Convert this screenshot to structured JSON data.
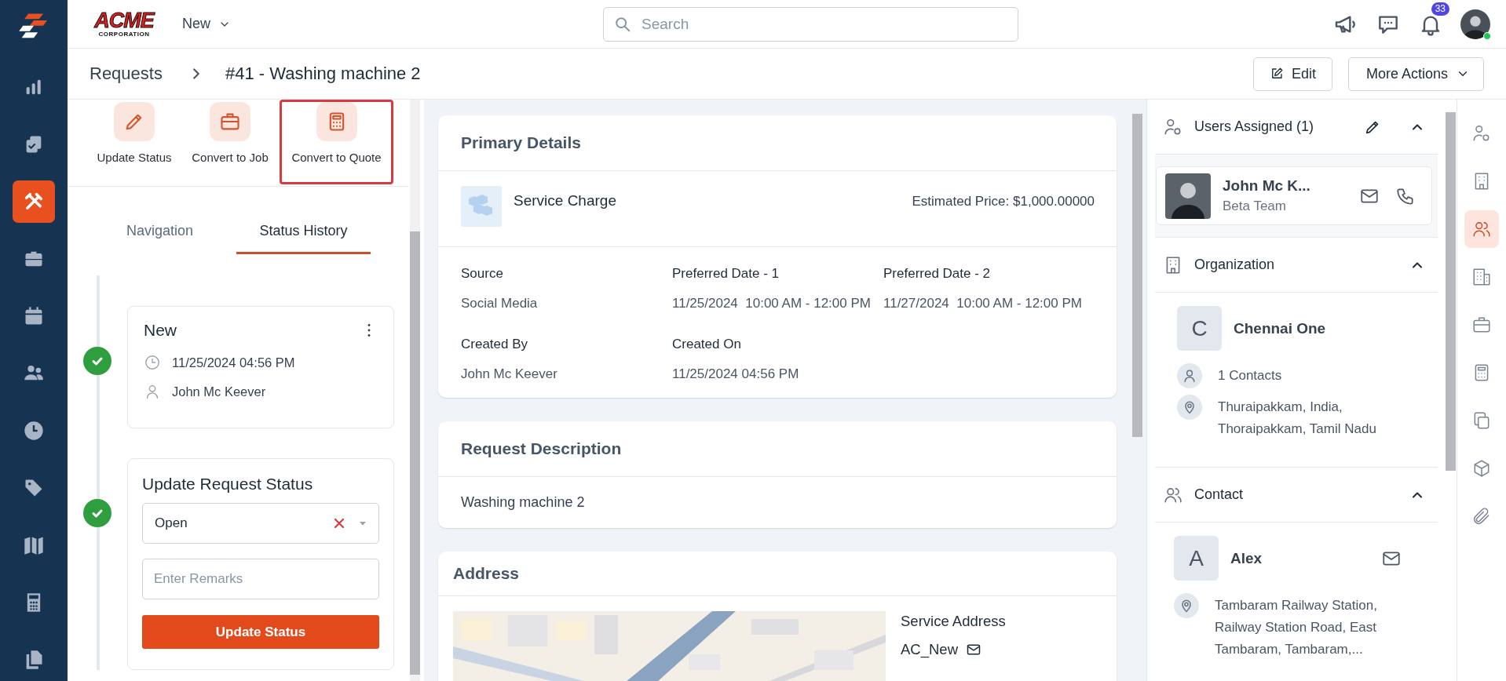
{
  "nav_rail": [
    {
      "selected": false
    },
    {
      "selected": false
    },
    {
      "selected": true
    },
    {
      "selected": false
    },
    {
      "selected": false
    },
    {
      "selected": false
    },
    {
      "selected": false
    },
    {
      "selected": false
    },
    {
      "selected": false
    },
    {
      "selected": false
    },
    {
      "selected": false
    }
  ],
  "top_bar": {
    "logo": "ACME",
    "logo_tagline": "CORPORATION",
    "new_menu": "New",
    "search": {
      "placeholder": "Search"
    },
    "notifications": "33",
    "online": true
  },
  "breadcrumb": [
    "Requests",
    "#41 - Washing machine 2"
  ],
  "header_buttons": [
    {
      "label": "Edit",
      "kind": "edit"
    },
    {
      "label": "More Actions",
      "kind": "menu"
    }
  ],
  "actions": [
    {
      "label": "Update Status",
      "highlighted": false
    },
    {
      "label": "Convert to Job",
      "highlighted": false
    },
    {
      "label": "Convert to Quote",
      "highlighted": true
    }
  ],
  "tabs": [
    {
      "label": "Navigation",
      "selected": false
    },
    {
      "label": "Status History",
      "selected": true
    }
  ],
  "status_history": [
    {
      "title": "New",
      "time": "11/25/2024 04:56 PM",
      "user": "John Mc Keever",
      "done": true
    }
  ],
  "update_status": {
    "title": "Update Request Status",
    "value": "Open",
    "remarks_placeholder": "Enter Remarks",
    "button": "Update Status",
    "done": true
  },
  "primary_details": {
    "title": "Primary Details",
    "item": "Service Charge",
    "estimated_price": "Estimated Price: $1,000.00000",
    "fields": [
      {
        "label": "Source",
        "value": "Social Media"
      },
      {
        "label": "Preferred Date - 1",
        "value": "11/25/2024  10:00 AM - 12:00 PM"
      },
      {
        "label": "Preferred Date - 2",
        "value": "11/27/2024  10:00 AM - 12:00 PM"
      },
      {
        "label": "Created By",
        "value": "John Mc Keever"
      },
      {
        "label": "Created On",
        "value": "11/25/2024 04:56 PM"
      }
    ]
  },
  "request_description": {
    "title": "Request Description",
    "text": "Washing machine 2"
  },
  "address": {
    "title": "Address",
    "label": "Service Address",
    "name": "AC_New"
  },
  "users_assigned": {
    "title": "Users Assigned (1)",
    "expanded": true,
    "users": [
      {
        "name": "John Mc K...",
        "team": "Beta Team"
      }
    ]
  },
  "organization": {
    "title": "Organization",
    "expanded": true,
    "initial": "C",
    "name": "Chennai One",
    "contacts": "1 Contacts",
    "location_lines": [
      "Thuraipakkam, India,",
      "Thoraipakkam, Tamil Nadu"
    ]
  },
  "contact": {
    "title": "Contact",
    "expanded": true,
    "initial": "A",
    "name": "Alex",
    "address_lines": [
      "Tambaram Railway Station,",
      "Railway Station Road, East",
      "Tambaram, Tambaram,..."
    ]
  },
  "side_rail": [
    {
      "selected": false
    },
    {
      "selected": false
    },
    {
      "selected": true
    },
    {
      "selected": false
    },
    {
      "selected": false
    },
    {
      "selected": false
    },
    {
      "selected": false
    },
    {
      "selected": false
    },
    {
      "selected": false
    }
  ]
}
